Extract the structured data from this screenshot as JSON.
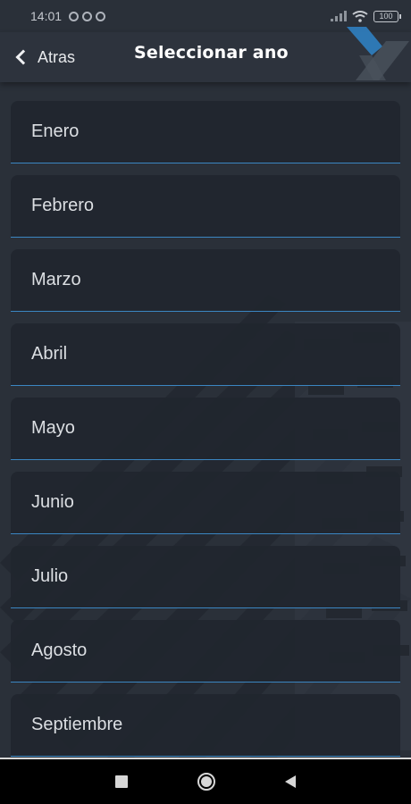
{
  "status_bar": {
    "time": "14:01",
    "battery": "100",
    "icons": [
      "notification-icon",
      "at-icon",
      "app-icon",
      "signal-icon",
      "wifi-icon",
      "battery-icon"
    ]
  },
  "app_bar": {
    "back_label": "Atras",
    "title": "Seleccionar ano"
  },
  "months": [
    {
      "label": "Enero"
    },
    {
      "label": "Febrero"
    },
    {
      "label": "Marzo"
    },
    {
      "label": "Abril"
    },
    {
      "label": "Mayo"
    },
    {
      "label": "Junio"
    },
    {
      "label": "Julio"
    },
    {
      "label": "Agosto"
    },
    {
      "label": "Septiembre"
    }
  ],
  "colors": {
    "background": "#2a3039",
    "item_background": "#21262e",
    "underline_accent": "#3b86c2",
    "logo_blue": "#2f7fc1"
  },
  "nav_bar": {
    "icons": [
      "recent-apps-icon",
      "home-icon",
      "back-triangle-icon"
    ]
  }
}
